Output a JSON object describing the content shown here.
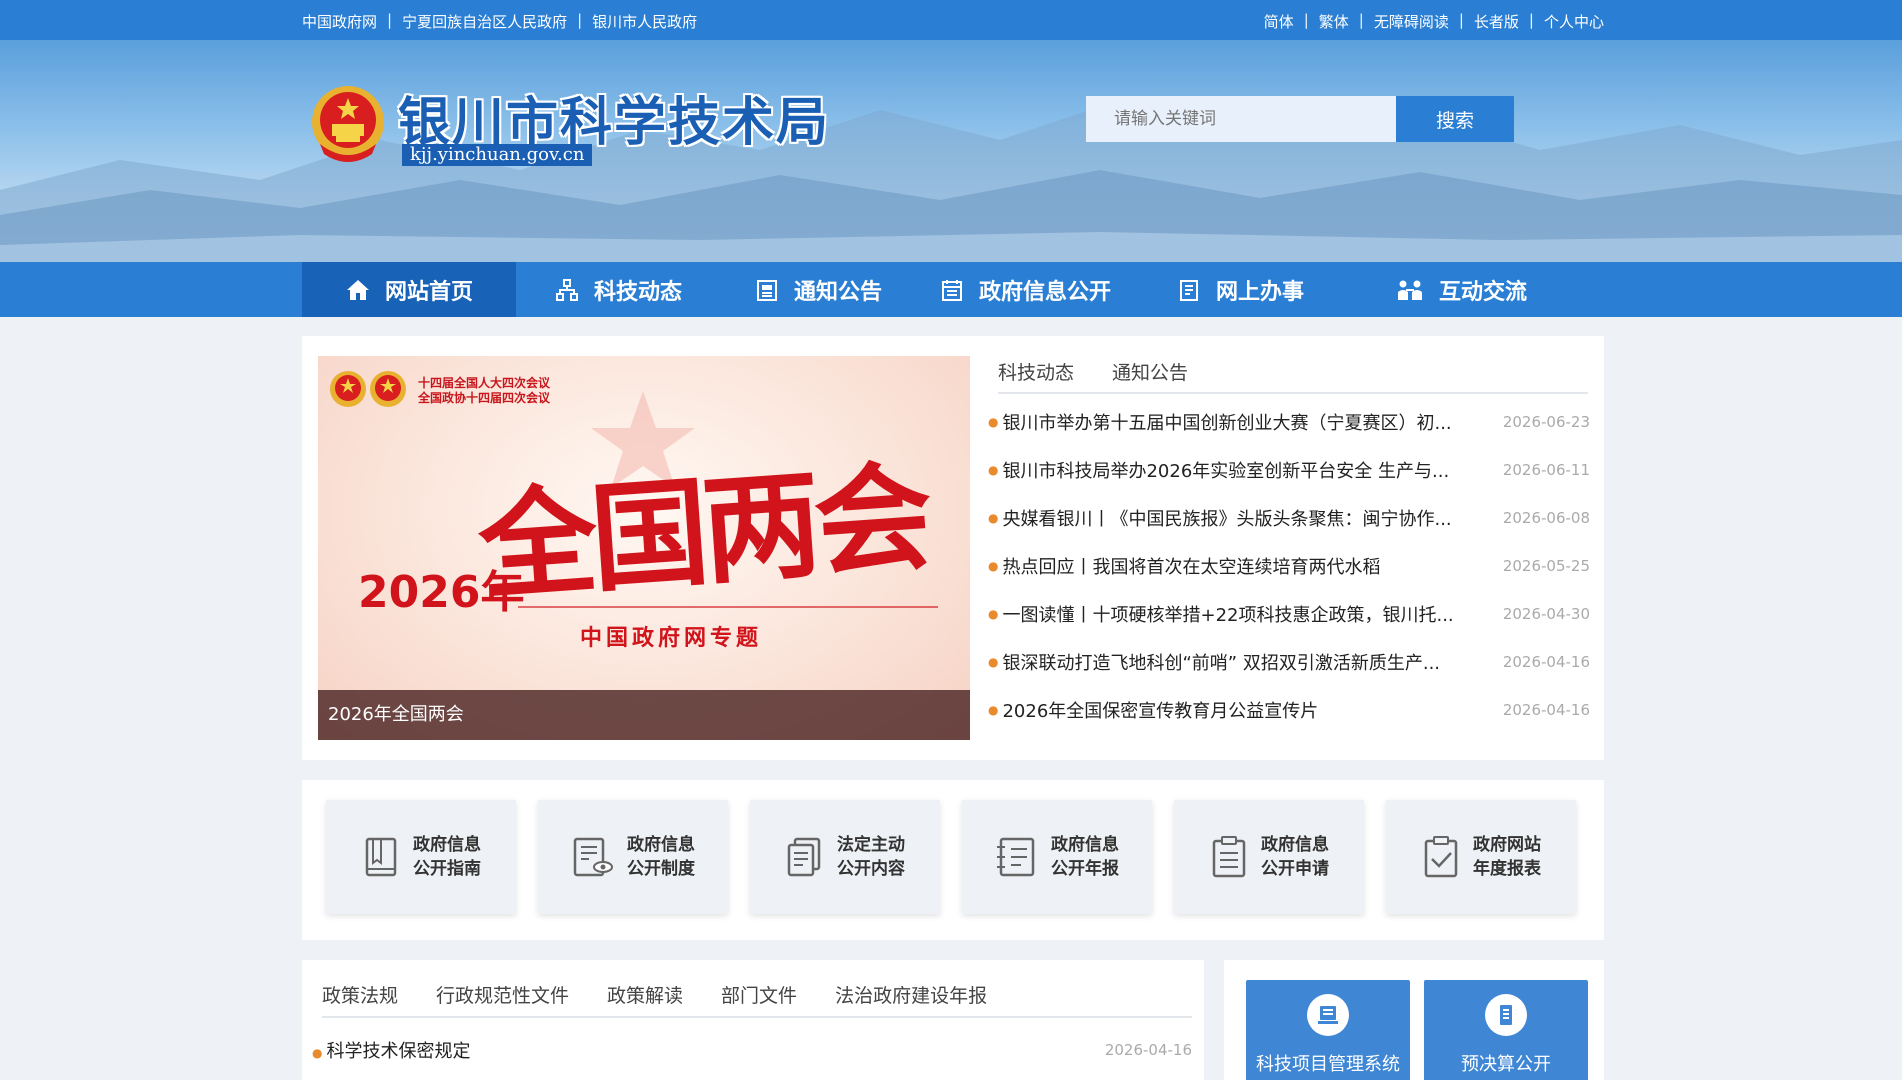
{
  "topbar": {
    "left_links": [
      "中国政府网",
      "宁夏回族自治区人民政府",
      "银川市人民政府"
    ],
    "right_links": [
      "简体",
      "繁体",
      "无障碍阅读",
      "长者版",
      "个人中心"
    ],
    "separator": "|"
  },
  "header": {
    "site_title": "银川市科学技术局",
    "site_domain": "kjj.yinchuan.gov.cn",
    "search_placeholder": "请输入关键词",
    "search_button": "搜索"
  },
  "nav": {
    "items": [
      {
        "label": "网站首页",
        "icon": "home-icon",
        "active": true
      },
      {
        "label": "科技动态",
        "icon": "org-chart-icon",
        "active": false
      },
      {
        "label": "通知公告",
        "icon": "notice-icon",
        "active": false
      },
      {
        "label": "政府信息公开",
        "icon": "calendar-icon",
        "active": false
      },
      {
        "label": "网上办事",
        "icon": "document-icon",
        "active": false
      },
      {
        "label": "互动交流",
        "icon": "people-icon",
        "active": false
      }
    ]
  },
  "banner": {
    "caption": "2026年全国两会",
    "header_lines": [
      "十四届全国人大四次会议",
      "全国政协十四届四次会议"
    ],
    "big_text": "全国两会",
    "year_text": "2026年",
    "subtitle": "中国政府网专题"
  },
  "news": {
    "tabs": [
      "科技动态",
      "通知公告"
    ],
    "items": [
      {
        "title": "银川市举办第十五届中国创新创业大赛（宁夏赛区）初...",
        "date": "2026-06-23"
      },
      {
        "title": "银川市科技局举办2026年实验室创新平台安全 生产与...",
        "date": "2026-06-11"
      },
      {
        "title": "央媒看银川丨《中国民族报》头版头条聚焦：闽宁协作...",
        "date": "2026-06-08"
      },
      {
        "title": "热点回应丨我国将首次在太空连续培育两代水稻",
        "date": "2026-05-25"
      },
      {
        "title": "一图读懂丨十项硬核举措+22项科技惠企政策，银川托...",
        "date": "2026-04-30"
      },
      {
        "title": "银深联动打造飞地科创“前哨” 双招双引激活新质生产...",
        "date": "2026-04-16"
      },
      {
        "title": "2026年全国保密宣传教育月公益宣传片",
        "date": "2026-04-16"
      }
    ]
  },
  "quick_links": [
    {
      "label": "政府信息\n公开指南",
      "icon": "book-icon"
    },
    {
      "label": "政府信息\n公开制度",
      "icon": "doc-eye-icon"
    },
    {
      "label": "法定主动\n公开内容",
      "icon": "docs-icon"
    },
    {
      "label": "政府信息\n公开年报",
      "icon": "report-icon"
    },
    {
      "label": "政府信息\n公开申请",
      "icon": "clipboard-icon"
    },
    {
      "label": "政府网站\n年度报表",
      "icon": "check-clipboard-icon"
    }
  ],
  "policy": {
    "tabs": [
      "政策法规",
      "行政规范性文件",
      "政策解读",
      "部门文件",
      "法治政府建设年报"
    ],
    "items": [
      {
        "title": "科学技术保密规定",
        "date": "2026-04-16"
      }
    ]
  },
  "side": {
    "cards": [
      {
        "label": "科技项目管理系统",
        "icon": "project-icon"
      },
      {
        "label": "预决算公开",
        "icon": "budget-icon"
      }
    ]
  },
  "colors": {
    "primary": "#2a7fd4",
    "nav_active": "#1862b8",
    "accent_dot": "#e98a2c",
    "banner_red": "#d1141b"
  }
}
